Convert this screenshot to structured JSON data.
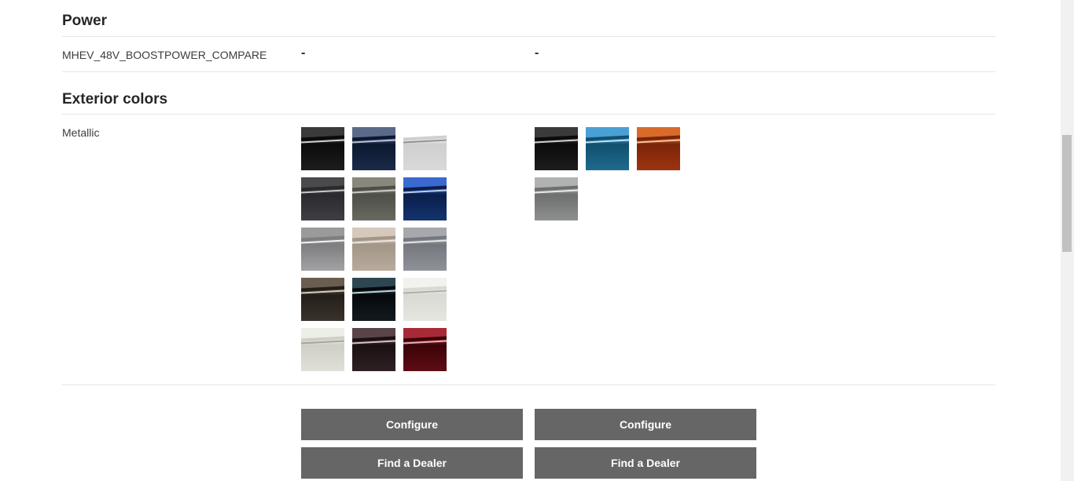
{
  "power": {
    "title": "Power",
    "row_label": "MHEV_48V_BOOSTPOWER_COMPARE",
    "col1_value": "-",
    "col2_value": "-"
  },
  "exterior": {
    "title": "Exterior colors",
    "row_label": "Metallic",
    "col1_swatches": [
      {
        "top": "#3a3a3a",
        "mid": "#0b0b0b",
        "bot": "#1d1d1d",
        "line": "#e6e6e6"
      },
      {
        "top": "#5c6a8a",
        "mid": "#0c1830",
        "bot": "#1a2a48",
        "line": "#c9d2e6"
      },
      {
        "top": "#ffffff",
        "mid": "#cfcfcf",
        "bot": "#d9d9d9",
        "line": "#8a8a8a"
      },
      {
        "top": "#4a4a4c",
        "mid": "#2a2a2e",
        "bot": "#3e3e44",
        "line": "#d8d8d8"
      },
      {
        "top": "#8a887c",
        "mid": "#4e4f48",
        "bot": "#686a60",
        "line": "#d8d6cc"
      },
      {
        "top": "#3a6ad0",
        "mid": "#0a1f4a",
        "bot": "#14336e",
        "line": "#cfe0ff"
      },
      {
        "top": "#9a9a9a",
        "mid": "#7e7e80",
        "bot": "#a3a3a6",
        "line": "#ffffff"
      },
      {
        "top": "#d6c8bc",
        "mid": "#a29686",
        "bot": "#b9ab9c",
        "line": "#f2ece6"
      },
      {
        "top": "#a6a8ac",
        "mid": "#74787e",
        "bot": "#8f9399",
        "line": "#f0f0f0"
      },
      {
        "top": "#6a5e50",
        "mid": "#241e1a",
        "bot": "#3a322c",
        "line": "#e8dccb"
      },
      {
        "top": "#2e4652",
        "mid": "#06090c",
        "bot": "#121a20",
        "line": "#cfe8f2"
      },
      {
        "top": "#f2f2ee",
        "mid": "#d9d9d4",
        "bot": "#e6e6e0",
        "line": "#a8a8a2"
      },
      {
        "top": "#eeeee8",
        "mid": "#cfcfc6",
        "bot": "#e0e0d8",
        "line": "#9e9e96"
      },
      {
        "top": "#5a4448",
        "mid": "#1a1012",
        "bot": "#2e2024",
        "line": "#e6d6d8"
      },
      {
        "top": "#a82a36",
        "mid": "#3a0408",
        "bot": "#5e0c14",
        "line": "#f2c6ca"
      }
    ],
    "col2_swatches": [
      {
        "top": "#3a3a3a",
        "mid": "#0b0b0b",
        "bot": "#1d1d1d",
        "line": "#e6e6e6"
      },
      {
        "top": "#4aa0d4",
        "mid": "#12506e",
        "bot": "#1e6a8e",
        "line": "#cff0ff"
      },
      {
        "top": "#d86a2a",
        "mid": "#7a2408",
        "bot": "#9e3410",
        "line": "#ffd4b0"
      },
      {
        "top": "#b0b2b2",
        "mid": "#6e7070",
        "bot": "#8e9090",
        "line": "#f4f4f4"
      }
    ]
  },
  "buttons": {
    "configure_label": "Configure",
    "dealer_label": "Find a Dealer"
  }
}
